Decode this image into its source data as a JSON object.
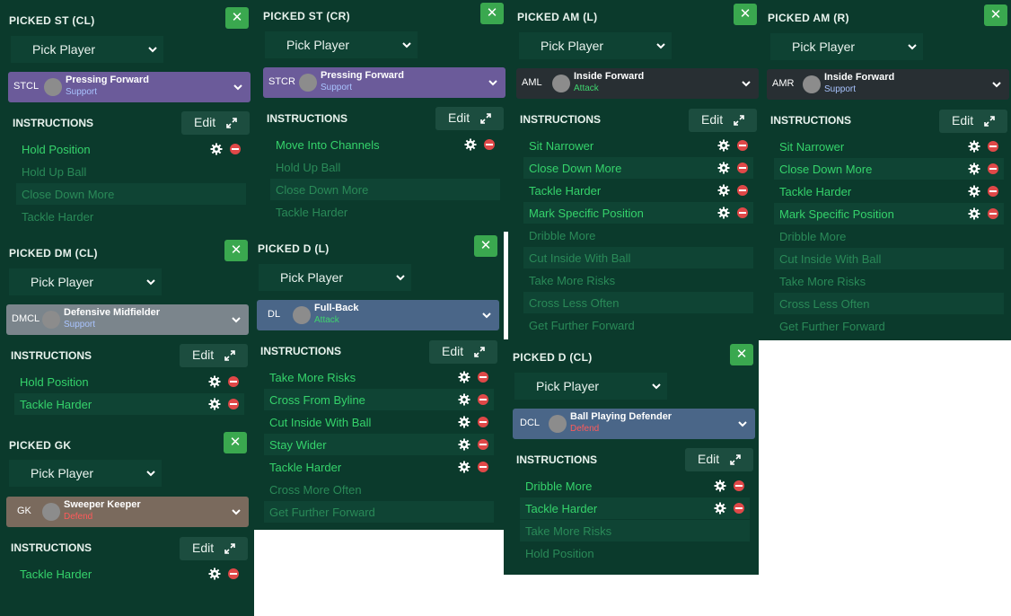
{
  "common": {
    "pick_label": "Pick Player",
    "instructions_label": "INSTRUCTIONS",
    "edit_label": "Edit",
    "close_symbol": "✕"
  },
  "colors": {
    "panel_bg": "#0b3a2c",
    "close_green": "#3aa84f",
    "active_text": "#35d36b",
    "inactive_text": "#2a8a58",
    "attack_text": "#3fd46e",
    "support_text": "#a9c4ff",
    "defend_text": "#ff5a5a",
    "role_purple": "#6b5b9a",
    "role_slate": "#282f33",
    "role_gray": "#7b858c",
    "role_blue": "#4a6688",
    "role_brown": "#7a6a5d"
  },
  "panels": {
    "st_cl": {
      "title": "PICKED ST (CL)",
      "pos": "STCL",
      "role": "Pressing Forward",
      "duty": "Support",
      "instructions": [
        "Hold Position",
        "Hold Up Ball",
        "Close Down More",
        "Tackle Harder"
      ]
    },
    "st_cr": {
      "title": "PICKED ST (CR)",
      "pos": "STCR",
      "role": "Pressing Forward",
      "duty": "Support",
      "instructions": [
        "Move Into Channels",
        "Hold Up Ball",
        "Close Down More",
        "Tackle Harder"
      ]
    },
    "am_l": {
      "title": "PICKED AM (L)",
      "pos": "AML",
      "role": "Inside Forward",
      "duty": "Attack",
      "instructions": [
        "Sit Narrower",
        "Close Down More",
        "Tackle Harder",
        "Mark Specific Position",
        "Dribble More",
        "Cut Inside With Ball",
        "Take More Risks",
        "Cross Less Often",
        "Get Further Forward"
      ]
    },
    "am_r": {
      "title": "PICKED AM (R)",
      "pos": "AMR",
      "role": "Inside Forward",
      "duty": "Support",
      "instructions": [
        "Sit Narrower",
        "Close Down More",
        "Tackle Harder",
        "Mark Specific Position",
        "Dribble More",
        "Cut Inside With Ball",
        "Take More Risks",
        "Cross Less Often",
        "Get Further Forward"
      ]
    },
    "dm_cl": {
      "title": "PICKED DM (CL)",
      "pos": "DMCL",
      "role": "Defensive Midfielder",
      "duty": "Support",
      "instructions": [
        "Hold Position",
        "Tackle Harder"
      ]
    },
    "d_l": {
      "title": "PICKED D (L)",
      "pos": "DL",
      "role": "Full-Back",
      "duty": "Attack",
      "instructions": [
        "Take More Risks",
        "Cross From Byline",
        "Cut Inside With Ball",
        "Stay Wider",
        "Tackle Harder",
        "Cross More Often",
        "Get Further Forward"
      ]
    },
    "d_cl": {
      "title": "PICKED D (CL)",
      "pos": "DCL",
      "role": "Ball Playing Defender",
      "duty": "Defend",
      "instructions": [
        "Dribble More",
        "Tackle Harder",
        "Take More Risks",
        "Hold Position"
      ]
    },
    "gk": {
      "title": "PICKED GK",
      "pos": "GK",
      "role": "Sweeper Keeper",
      "duty": "Defend",
      "instructions": [
        "Tackle Harder"
      ]
    }
  }
}
